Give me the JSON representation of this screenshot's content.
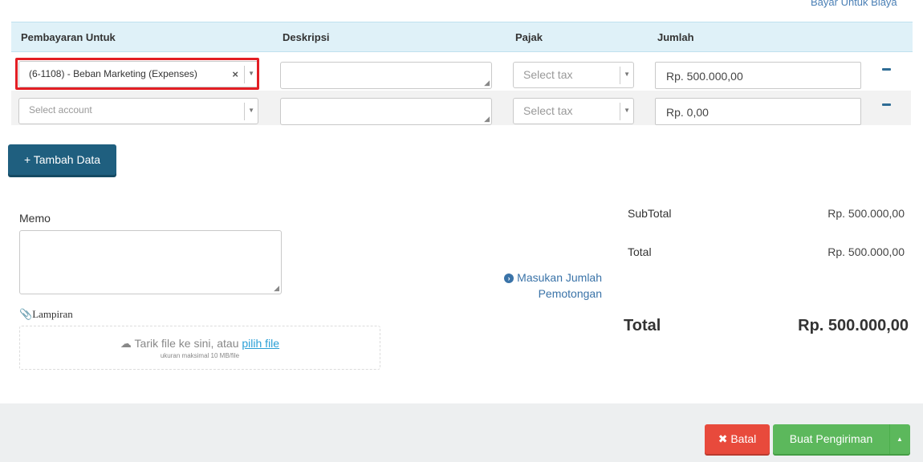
{
  "top_link": "Bayar Untuk Biaya",
  "table": {
    "headers": [
      "Pembayaran Untuk",
      "Deskripsi",
      "Pajak",
      "Jumlah"
    ],
    "rows": [
      {
        "account": "(6-1108) - Beban Marketing (Expenses)",
        "description": "",
        "tax_placeholder": "Select tax",
        "amount": "Rp. 500.000,00"
      },
      {
        "account_placeholder": "Select account",
        "description": "",
        "tax_placeholder": "Select tax",
        "amount": "Rp. 0,00"
      }
    ]
  },
  "add_button": "+ Tambah Data",
  "memo_label": "Memo",
  "attachment": {
    "label": "Lampiran",
    "drop_text": "Tarik file ke sini, atau",
    "pick_link": "pilih file",
    "size_hint": "ukuran maksimal 10 MB/file"
  },
  "deduction_link": {
    "line1": "Masukan Jumlah",
    "line2": "Pemotongan"
  },
  "summary": {
    "subtotal_label": "SubTotal",
    "subtotal_value": "Rp. 500.000,00",
    "total_label": "Total",
    "total_value": "Rp. 500.000,00",
    "grand_total_label": "Total",
    "grand_total_value": "Rp. 500.000,00"
  },
  "footer": {
    "cancel": "Batal",
    "submit": "Buat Pengiriman"
  },
  "colors": {
    "header_bg": "#dff1f8",
    "primary": "#1f5f7f",
    "danger": "#e84a3c",
    "success": "#5cb85c",
    "highlight": "#e31e24"
  }
}
